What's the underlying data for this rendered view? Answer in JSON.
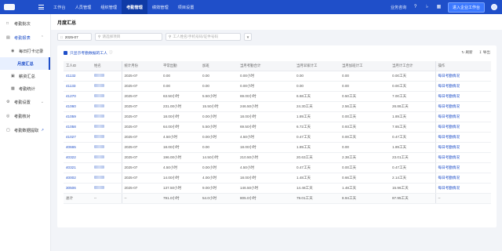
{
  "topbar": {
    "nav": [
      "工作台",
      "人员管理",
      "组织管理",
      "考勤管理",
      "绩效管理",
      "项目设置"
    ],
    "active_index": 3,
    "consult": "业务咨询",
    "help": "帮助",
    "join_label": "进入企业工作台"
  },
  "sidebar": {
    "items": [
      {
        "label": "考勤批次",
        "icon": "calendar-icon"
      },
      {
        "label": "考勤报表",
        "icon": "report-icon"
      },
      {
        "label": "每日打卡记录",
        "icon": "clock-icon"
      },
      {
        "label": "月度汇总",
        "icon": ""
      },
      {
        "label": "薪资汇总",
        "icon": "doc-icon"
      },
      {
        "label": "考勤统计",
        "icon": "stats-icon"
      },
      {
        "label": "考勤设置",
        "icon": "gear-icon"
      },
      {
        "label": "考勤核对",
        "icon": "check-icon"
      },
      {
        "label": "考勤数据提取",
        "icon": "export-icon"
      }
    ]
  },
  "page": {
    "title": "月度汇总",
    "month_value": "2025-07",
    "project_placeholder": "请选择项目",
    "search_placeholder": "工人姓名/手机号码/证件号码",
    "only_show_label": "只显示考勤数据的工人",
    "refresh_label": "刷新",
    "export_label": "导出"
  },
  "table": {
    "headers": [
      "工人ID",
      "姓名",
      "统计月份",
      "平常出勤",
      "加班",
      "当月考勤合计",
      "当月早家计工",
      "当月加班计工",
      "当月计工合计",
      "操作"
    ],
    "rows": [
      {
        "id": "41132",
        "month": "2025-07",
        "normal": "0.00",
        "overtime": "0.00",
        "att_total": "0.00小时",
        "early": "0.00",
        "ot_work": "0.00",
        "work_total": "0.00工天",
        "action": "每日考勤情况"
      },
      {
        "id": "41133",
        "month": "2025-07",
        "normal": "0.00",
        "overtime": "0.00",
        "att_total": "0.00小时",
        "early": "0.00",
        "ot_work": "0.00",
        "work_total": "0.00工天",
        "action": "每日考勤情况"
      },
      {
        "id": "41270",
        "month": "2025-07",
        "normal": "63.50小时",
        "overtime": "5.50小时",
        "att_total": "69.00小时",
        "early": "6.68工天",
        "ot_work": "0.50工天",
        "work_total": "7.00工天",
        "action": "每日考勤情况"
      },
      {
        "id": "41060",
        "month": "2025-07",
        "normal": "231.00小时",
        "overtime": "15.50小时",
        "att_total": "246.50小时",
        "early": "24.30工天",
        "ot_work": "2.56工天",
        "work_total": "26.86工天",
        "action": "每日考勤情况"
      },
      {
        "id": "41059",
        "month": "2025-07",
        "normal": "18.00小时",
        "overtime": "0.00小时",
        "att_total": "18.00小时",
        "early": "1.89工天",
        "ot_work": "0.00工天",
        "work_total": "1.89工天",
        "action": "每日考勤情况"
      },
      {
        "id": "41058",
        "month": "2025-07",
        "normal": "64.00小时",
        "overtime": "5.50小时",
        "att_total": "69.50小时",
        "early": "6.72工天",
        "ot_work": "0.93工天",
        "work_total": "7.65工天",
        "action": "每日考勤情况"
      },
      {
        "id": "41027",
        "month": "2025-07",
        "normal": "4.50小时",
        "overtime": "0.00小时",
        "att_total": "4.50小时",
        "early": "0.47工天",
        "ot_work": "0.00工天",
        "work_total": "0.47工天",
        "action": "每日考勤情况"
      },
      {
        "id": "40665",
        "month": "2025-07",
        "normal": "18.00小时",
        "overtime": "0.00",
        "att_total": "18.00小时",
        "early": "1.89工天",
        "ot_work": "0.00",
        "work_total": "1.89工天",
        "action": "每日考勤情况"
      },
      {
        "id": "40322",
        "month": "2025-07",
        "normal": "196.00小时",
        "overtime": "14.50小时",
        "att_total": "210.50小时",
        "early": "20.63工天",
        "ot_work": "2.38工天",
        "work_total": "23.01工天",
        "action": "每日考勤情况"
      },
      {
        "id": "40321",
        "month": "2025-07",
        "normal": "4.50小时",
        "overtime": "0.00小时",
        "att_total": "4.50小时",
        "early": "0.47工天",
        "ot_work": "0.00工天",
        "work_total": "0.47工天",
        "action": "每日考勤情况"
      },
      {
        "id": "40002",
        "month": "2025-07",
        "normal": "14.00小时",
        "overtime": "4.00小时",
        "att_total": "18.00小时",
        "early": "1.48工天",
        "ot_work": "0.66工天",
        "work_total": "2.14工天",
        "action": "每日考勤情况"
      },
      {
        "id": "30506",
        "month": "2025-07",
        "normal": "137.50小时",
        "overtime": "9.00小时",
        "att_total": "146.50小时",
        "early": "14.48工天",
        "ot_work": "1.48工天",
        "work_total": "15.96工天",
        "action": "每日考勤情况"
      }
    ],
    "total": {
      "label": "总计",
      "dash": "--",
      "normal": "791.0小时",
      "overtime": "54.0小时",
      "att_total": "805.0小时",
      "early": "79.01工天",
      "ot_work": "8.94工天",
      "work_total": "87.95工天",
      "action": "--"
    }
  }
}
